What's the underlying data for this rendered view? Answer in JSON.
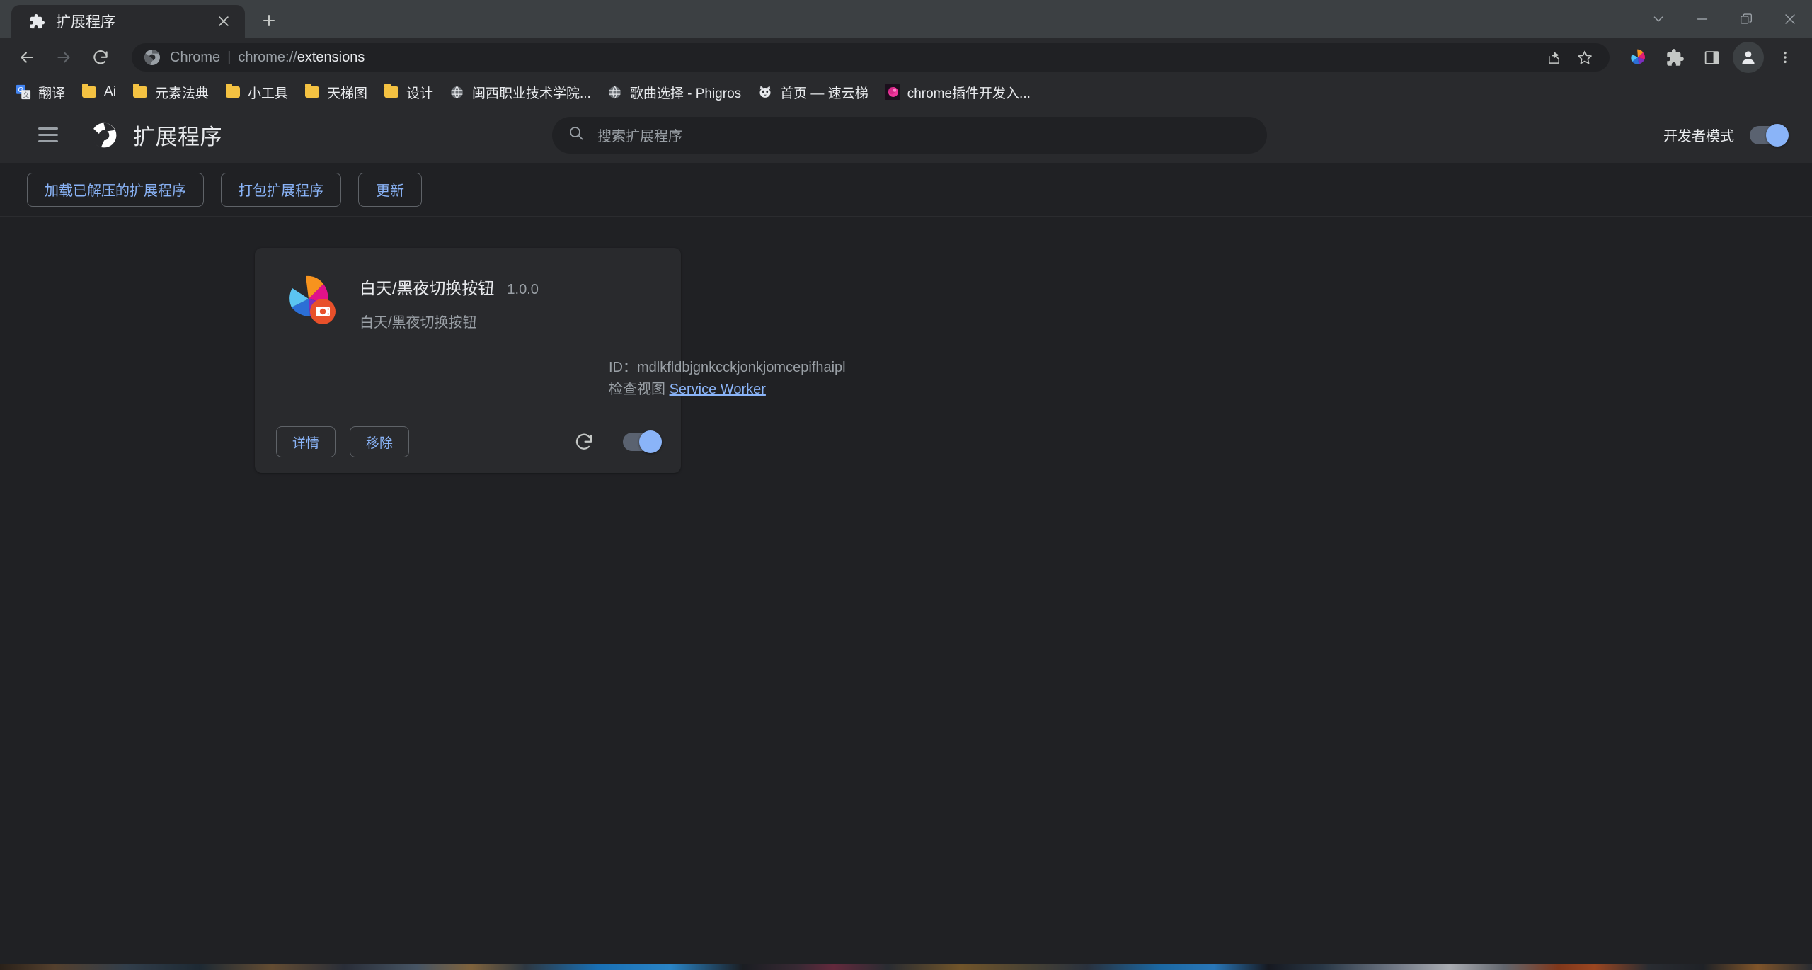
{
  "window": {
    "controls": [
      {
        "name": "tab-search-button",
        "icon": "chevron-down-icon"
      },
      {
        "name": "minimize-button",
        "icon": "minimize-icon"
      },
      {
        "name": "restore-button",
        "icon": "restore-icon"
      },
      {
        "name": "close-button",
        "icon": "close-icon"
      }
    ]
  },
  "tabstrip": {
    "tab": {
      "title": "扩展程序",
      "favicon": "puzzle-piece-icon",
      "close_label": "×"
    },
    "new_tab_label": "+"
  },
  "toolbar": {
    "back": "back-arrow-icon",
    "forward": "forward-arrow-icon",
    "reload": "reload-icon",
    "omnibox": {
      "site_icon": "chrome-logo-icon",
      "scheme_label": "Chrome",
      "separator": "|",
      "url_prefix": "chrome://",
      "url_main": "extensions",
      "share_icon": "share-icon",
      "bookmark_icon": "star-icon"
    },
    "extension_icon": "extensions-pinwheel-icon",
    "puzzle_icon": "puzzle-piece-icon",
    "side_panel_icon": "side-panel-icon",
    "avatar_icon": "profile-avatar-icon",
    "menu_icon": "three-dot-menu-icon"
  },
  "bookmarks": [
    {
      "label": "翻译",
      "icon": "google-translate-icon"
    },
    {
      "label": "Ai",
      "icon": "folder-icon"
    },
    {
      "label": "元素法典",
      "icon": "folder-icon"
    },
    {
      "label": "小工具",
      "icon": "folder-icon"
    },
    {
      "label": "天梯图",
      "icon": "folder-icon"
    },
    {
      "label": "设计",
      "icon": "folder-icon"
    },
    {
      "label": "闽西职业技术学院...",
      "icon": "globe-icon"
    },
    {
      "label": "歌曲选择 - Phigros",
      "icon": "globe-icon"
    },
    {
      "label": "首页 — 速云梯",
      "icon": "cat-icon"
    },
    {
      "label": "chrome插件开发入...",
      "icon": "pink-sphere-icon"
    }
  ],
  "extensions_page": {
    "header": {
      "menu_icon": "hamburger-menu-icon",
      "logo_icon": "chrome-logo-icon",
      "title": "扩展程序",
      "search_placeholder": "搜索扩展程序",
      "search_value": "",
      "search_icon": "search-icon",
      "dev_mode_label": "开发者模式",
      "dev_mode_on": true
    },
    "actions": {
      "load_unpacked": "加载已解压的扩展程序",
      "pack_extension": "打包扩展程序",
      "update": "更新"
    },
    "cards": [
      {
        "name": "白天/黑夜切换按钮",
        "version": "1.0.0",
        "description": "白天/黑夜切换按钮",
        "id_label": "ID：",
        "id_value": "mdlkfldbjgnkcckjonkjomcepifhaipl",
        "views_label": "检查视图",
        "view_link": "Service Worker",
        "details_label": "详情",
        "remove_label": "移除",
        "reload_icon": "reload-icon",
        "enabled": true,
        "icon": "color-pinwheel-icon"
      }
    ]
  },
  "colors": {
    "page_bg": "#202124",
    "surface": "#292a2d",
    "chrome_frame": "#3c4043",
    "accent_blue": "#8ab4f8",
    "text_primary": "#e8eaed",
    "text_secondary": "#9aa0a6",
    "toggle_track": "#5a6270",
    "badge_orange": "#e8502a"
  }
}
